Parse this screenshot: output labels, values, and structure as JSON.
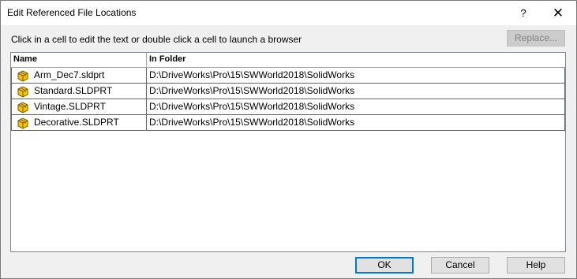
{
  "window": {
    "title": "Edit Referenced File Locations",
    "help_glyph": "?",
    "close_glyph": "✕"
  },
  "instruction": "Click in a cell to edit the text or double click a cell to launch a browser",
  "toolbar": {
    "replace_label": "Replace..."
  },
  "grid": {
    "columns": {
      "name": "Name",
      "folder": "In Folder"
    },
    "rows": [
      {
        "name": "Arm_Dec7.sldprt",
        "folder": "D:\\DriveWorks\\Pro\\15\\SWWorld2018\\SolidWorks",
        "icon": "part-icon"
      },
      {
        "name": "Standard.SLDPRT",
        "folder": "D:\\DriveWorks\\Pro\\15\\SWWorld2018\\SolidWorks",
        "icon": "part-icon"
      },
      {
        "name": "Vintage.SLDPRT",
        "folder": "D:\\DriveWorks\\Pro\\15\\SWWorld2018\\SolidWorks",
        "icon": "part-icon"
      },
      {
        "name": "Decorative.SLDPRT",
        "folder": "D:\\DriveWorks\\Pro\\15\\SWWorld2018\\SolidWorks",
        "icon": "part-icon"
      }
    ]
  },
  "buttons": {
    "ok": "OK",
    "cancel": "Cancel",
    "help": "Help"
  },
  "colors": {
    "accent": "#0078d7",
    "part_icon": "#f5c400"
  }
}
